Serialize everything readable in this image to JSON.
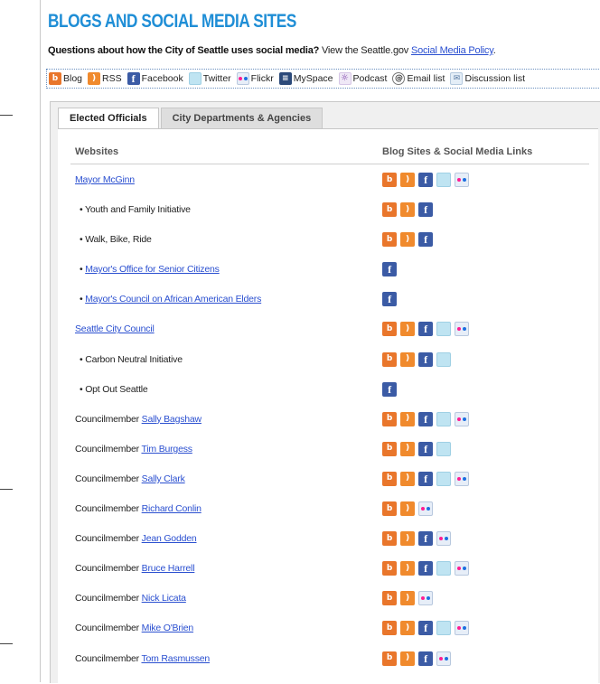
{
  "title": "BLOGS AND SOCIAL MEDIA SITES",
  "question": {
    "bold": "Questions about how the City of Seattle uses social media?",
    "text": " View the Seattle.gov ",
    "link": "Social Media Policy",
    "end": "."
  },
  "legend": [
    {
      "icon": "blog-icon",
      "label": "Blog"
    },
    {
      "icon": "rss-icon",
      "label": "RSS"
    },
    {
      "icon": "facebook-icon",
      "label": "Facebook"
    },
    {
      "icon": "twitter-icon",
      "label": "Twitter"
    },
    {
      "icon": "flickr-icon",
      "label": "Flickr"
    },
    {
      "icon": "myspace-icon",
      "label": "MySpace"
    },
    {
      "icon": "podcast-icon",
      "label": "Podcast"
    },
    {
      "icon": "email-icon",
      "label": "Email list"
    },
    {
      "icon": "discussion-icon",
      "label": "Discussion list"
    }
  ],
  "tabs": [
    {
      "label": "Elected Officials",
      "active": true
    },
    {
      "label": "City Departments & Agencies",
      "active": false
    }
  ],
  "table": {
    "col_websites": "Websites",
    "col_links": "Blog Sites & Social Media Links",
    "rows": [
      {
        "prefix": "",
        "link": "Mayor McGinn",
        "indent": false,
        "icons": [
          "blog",
          "rss",
          "facebook",
          "twitter",
          "flickr"
        ]
      },
      {
        "prefix": "• Youth and Family Initiative",
        "link": "",
        "indent": true,
        "icons": [
          "blog",
          "rss",
          "facebook"
        ]
      },
      {
        "prefix": "• Walk, Bike, Ride",
        "link": "",
        "indent": true,
        "icons": [
          "blog",
          "rss",
          "facebook"
        ]
      },
      {
        "prefix": "• ",
        "link": "Mayor's Office for Senior Citizens",
        "indent": true,
        "icons": [
          "facebook"
        ]
      },
      {
        "prefix": "• ",
        "link": "Mayor's Council on African American Elders",
        "indent": true,
        "icons": [
          "facebook"
        ]
      },
      {
        "prefix": "",
        "link": "Seattle City Council",
        "indent": false,
        "icons": [
          "blog",
          "rss",
          "facebook",
          "twitter",
          "flickr"
        ]
      },
      {
        "prefix": "• Carbon Neutral Initiative",
        "link": "",
        "indent": true,
        "icons": [
          "blog",
          "rss",
          "facebook",
          "twitter"
        ]
      },
      {
        "prefix": "• Opt Out Seattle",
        "link": "",
        "indent": true,
        "icons": [
          "facebook"
        ]
      },
      {
        "prefix": "Councilmember ",
        "link": "Sally Bagshaw",
        "indent": false,
        "icons": [
          "blog",
          "rss",
          "facebook",
          "twitter",
          "flickr"
        ]
      },
      {
        "prefix": "Councilmember ",
        "link": "Tim Burgess",
        "indent": false,
        "icons": [
          "blog",
          "rss",
          "facebook",
          "twitter"
        ]
      },
      {
        "prefix": "Councilmember ",
        "link": "Sally Clark",
        "indent": false,
        "icons": [
          "blog",
          "rss",
          "facebook",
          "twitter",
          "flickr"
        ]
      },
      {
        "prefix": "Councilmember ",
        "link": "Richard Conlin",
        "indent": false,
        "icons": [
          "blog",
          "rss",
          "flickr"
        ]
      },
      {
        "prefix": "Councilmember ",
        "link": "Jean Godden",
        "indent": false,
        "icons": [
          "blog",
          "rss",
          "facebook",
          "flickr"
        ]
      },
      {
        "prefix": "Councilmember ",
        "link": "Bruce Harrell",
        "indent": false,
        "icons": [
          "blog",
          "rss",
          "facebook",
          "twitter",
          "flickr"
        ]
      },
      {
        "prefix": "Councilmember ",
        "link": "Nick Licata",
        "indent": false,
        "icons": [
          "blog",
          "rss",
          "flickr"
        ]
      },
      {
        "prefix": "Councilmember ",
        "link": "Mike O'Brien",
        "indent": false,
        "icons": [
          "blog",
          "rss",
          "facebook",
          "twitter",
          "flickr"
        ]
      },
      {
        "prefix": "Councilmember ",
        "link": "Tom Rasmussen",
        "indent": false,
        "icons": [
          "blog",
          "rss",
          "facebook",
          "flickr"
        ]
      }
    ]
  },
  "colors": {
    "title": "#1f8ed6",
    "link": "#2a4fd0",
    "blog": "#e9762b",
    "facebook": "#3b5ba5"
  }
}
